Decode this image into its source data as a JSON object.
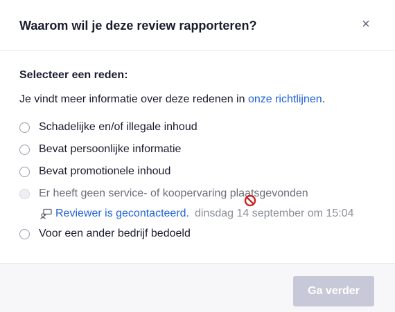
{
  "dialog": {
    "title": "Waarom wil je deze review rapporteren?",
    "close_glyph": "×"
  },
  "body": {
    "section_label": "Selecteer een reden:",
    "info_text": "Je vindt meer informatie over deze redenen in ",
    "info_link": "onze richtlijnen",
    "info_suffix": "."
  },
  "options": [
    {
      "label": "Schadelijke en/of illegale inhoud",
      "disabled": false
    },
    {
      "label": "Bevat persoonlijke informatie",
      "disabled": false
    },
    {
      "label": "Bevat promotionele inhoud",
      "disabled": false
    },
    {
      "label": "Er heeft geen service- of koopervaring plaatsgevonden",
      "disabled": true
    },
    {
      "label": "Voor een ander bedrijf bedoeld",
      "disabled": false
    }
  ],
  "contacted": {
    "icon": "reviewer-contacted-icon",
    "link": "Reviewer is gecontacteerd.",
    "date": "dinsdag 14 september om 15:04"
  },
  "cursor": {
    "icon": "not-allowed-cursor-icon"
  },
  "footer": {
    "continue_label": "Ga verder",
    "continue_disabled": true
  },
  "colors": {
    "link": "#1e62d8",
    "button_disabled": "#c8c9d8",
    "footer_bg": "#f7f7f9"
  }
}
